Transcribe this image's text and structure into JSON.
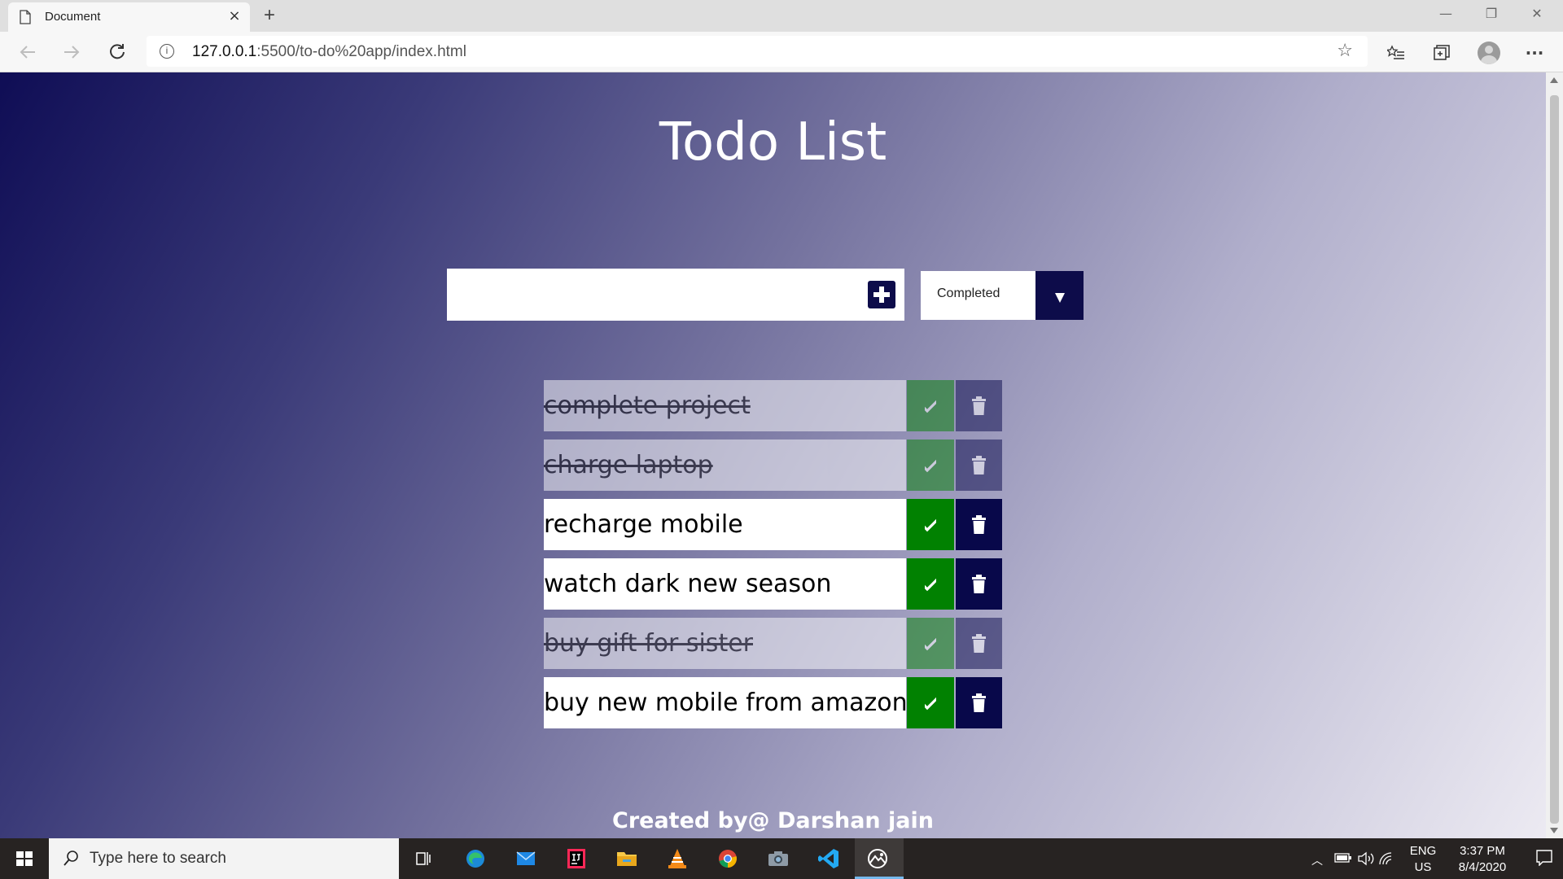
{
  "browser": {
    "tab_title": "Document",
    "tab_close": "×",
    "new_tab": "+",
    "url_host": "127.0.0.1",
    "url_rest": ":5500/to-do%20app/index.html",
    "window_controls": [
      "—",
      "❐",
      "✕"
    ]
  },
  "page": {
    "title": "Todo List",
    "input": {
      "value": "",
      "placeholder": ""
    },
    "filter": {
      "selected": "Completed"
    },
    "todos": [
      {
        "text": "complete project",
        "completed": true
      },
      {
        "text": "charge laptop",
        "completed": true
      },
      {
        "text": "recharge mobile",
        "completed": false
      },
      {
        "text": "watch dark new season",
        "completed": false
      },
      {
        "text": "buy gift for sister",
        "completed": true
      },
      {
        "text": "buy new mobile from amazon",
        "completed": false
      }
    ],
    "footer": "Created by@ Darshan jain",
    "colors": {
      "check": "#018101",
      "trash": "#08084a",
      "accent": "#0d0c4a"
    }
  },
  "taskbar": {
    "search_placeholder": "Type here to search",
    "language": "ENG",
    "region": "US",
    "time": "3:37 PM",
    "date": "8/4/2020",
    "apps": [
      "task-view",
      "edge",
      "mail",
      "intellij",
      "file-explorer",
      "vlc",
      "chrome",
      "camera",
      "vscode",
      "photos"
    ]
  }
}
